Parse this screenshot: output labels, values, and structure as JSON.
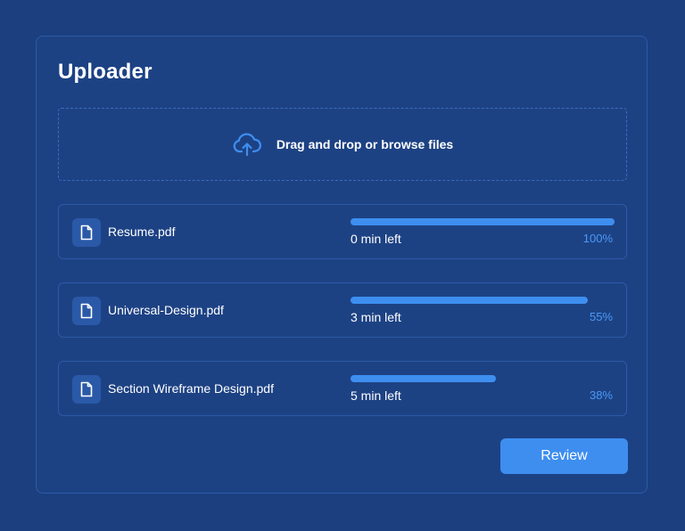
{
  "uploader": {
    "title": "Uploader",
    "dropzone": {
      "text": "Drag and drop or browse files",
      "icon": "cloud-upload-icon"
    },
    "files": [
      {
        "name": "Resume.pdf",
        "time_left": "0 min left",
        "percent_label": "100%",
        "progress": 1.0,
        "icon": "file-icon"
      },
      {
        "name": "Universal-Design.pdf",
        "time_left": "3 min left",
        "percent_label": "55%",
        "progress": 0.9,
        "icon": "file-icon"
      },
      {
        "name": "Section Wireframe Design.pdf",
        "time_left": "5 min left",
        "percent_label": "38%",
        "progress": 0.55,
        "icon": "file-icon"
      }
    ],
    "review_label": "Review"
  },
  "colors": {
    "background": "#1b3f7f",
    "card": "#1d4284",
    "border": "#2d5aa6",
    "accent": "#3e8ef0",
    "percent_text": "#4a99f5"
  }
}
